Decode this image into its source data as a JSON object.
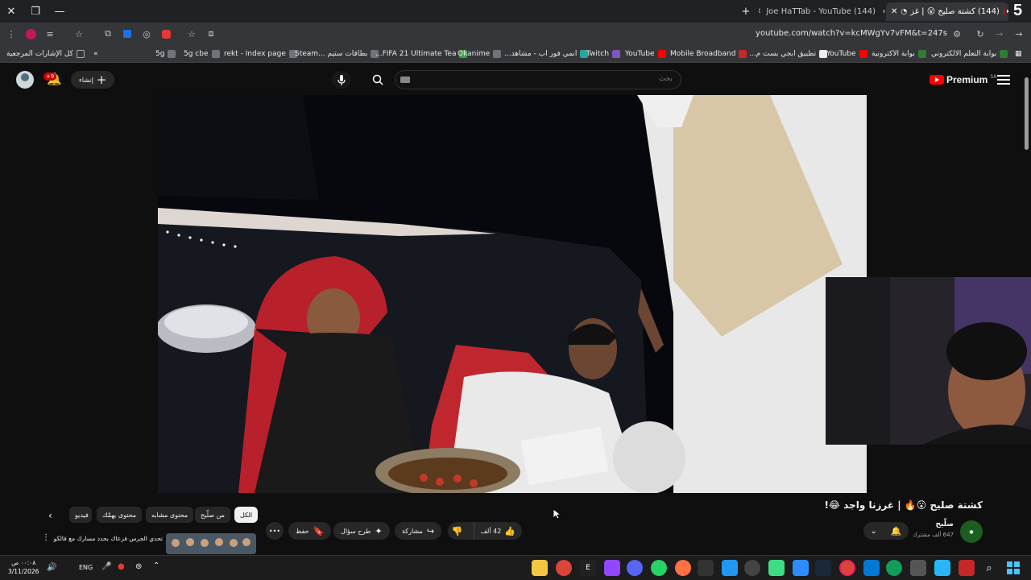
{
  "browser": {
    "badge": "5",
    "tabs": [
      {
        "title": "(144) كشتة صليح 😮 | غز"
      },
      {
        "title": "(144) Joe HaTTab - YouTube"
      }
    ],
    "new_tab": "+",
    "url": "youtube.com/watch?v=kcMWgYv7vFM&t=247s"
  },
  "bookmarks": [
    "بوابة التعلم الالكتروني",
    "بوابة الاكترونية",
    "YouTube",
    "تطبيق ابجي بست م...",
    "Mobile Broadband",
    "YouTube",
    "Twitch",
    "انمي فور اب - مشاهد...",
    "Okanime",
    "FIFA 21 Ultimate Tea...",
    "بطاقات ستيم ...Steam",
    "rekt - Index page",
    "5g cbe",
    "5g"
  ],
  "bookmarks_folder": "كل الإشارات المرجعية",
  "youtube": {
    "logo_text": "Premium",
    "logo_region": "SA",
    "search_placeholder": "بحث",
    "create_label": "إنشاء",
    "notification_count": "+9",
    "video": {
      "title": "كشتة صليح 😮🔥 | غرزنا واجد 😂!",
      "channel": "صلّيح",
      "subscribers": "647 ألف مشترك",
      "likes": "42 ألف",
      "share_label": "مشاركة",
      "ask_label": "طرح سؤال",
      "save_label": "حفظ"
    },
    "chips": [
      {
        "label": "الكل",
        "selected": true
      },
      {
        "label": "من صلّيح",
        "selected": false
      },
      {
        "label": "محتوى مشابه",
        "selected": false
      },
      {
        "label": "محتوى يهمّك",
        "selected": false
      },
      {
        "label": "فيديو",
        "selected": false
      }
    ],
    "up_next": {
      "title": "تحدي الجرس فزعاك بحدد مسارك مع فالكونز"
    }
  },
  "taskbar": {
    "time": "٠٠:٠٨ ص",
    "date": "3/11/2026",
    "lang": "ENG"
  },
  "colors": {
    "yt_red": "#ff0000",
    "bg": "#0f0f0f",
    "chip": "#272727"
  }
}
